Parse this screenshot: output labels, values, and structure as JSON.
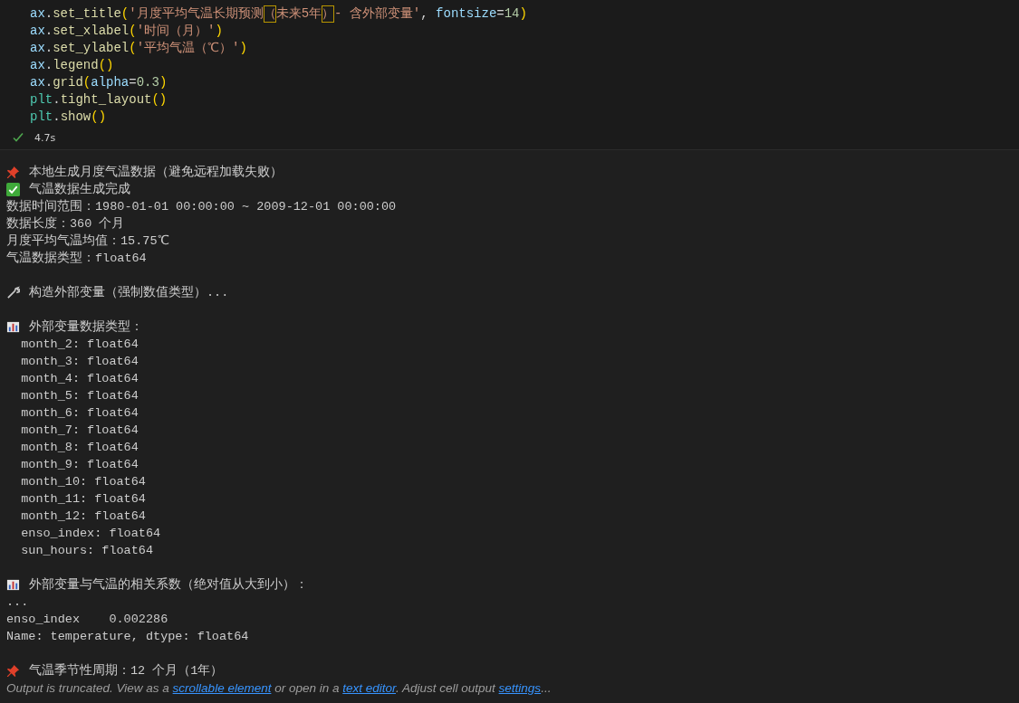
{
  "code_lines": [
    [
      {
        "kind": "var",
        "text": "ax"
      },
      {
        "kind": "op",
        "text": "."
      },
      {
        "kind": "fn",
        "text": "set_title"
      },
      {
        "kind": "paren",
        "text": "("
      },
      {
        "kind": "str",
        "text": "'月度平均气温长期预测"
      },
      {
        "kind": "str-match",
        "text": "（"
      },
      {
        "kind": "str",
        "text": "未来5年"
      },
      {
        "kind": "str-match",
        "text": "）"
      },
      {
        "kind": "str",
        "text": "- 含外部变量'"
      },
      {
        "kind": "op",
        "text": ", "
      },
      {
        "kind": "var",
        "text": "fontsize"
      },
      {
        "kind": "op",
        "text": "="
      },
      {
        "kind": "num",
        "text": "14"
      },
      {
        "kind": "paren",
        "text": ")"
      }
    ],
    [
      {
        "kind": "var",
        "text": "ax"
      },
      {
        "kind": "op",
        "text": "."
      },
      {
        "kind": "fn",
        "text": "set_xlabel"
      },
      {
        "kind": "paren",
        "text": "("
      },
      {
        "kind": "str",
        "text": "'时间（月）'"
      },
      {
        "kind": "paren",
        "text": ")"
      }
    ],
    [
      {
        "kind": "var",
        "text": "ax"
      },
      {
        "kind": "op",
        "text": "."
      },
      {
        "kind": "fn",
        "text": "set_ylabel"
      },
      {
        "kind": "paren",
        "text": "("
      },
      {
        "kind": "str",
        "text": "'平均气温（℃）'"
      },
      {
        "kind": "paren",
        "text": ")"
      }
    ],
    [
      {
        "kind": "var",
        "text": "ax"
      },
      {
        "kind": "op",
        "text": "."
      },
      {
        "kind": "fn",
        "text": "legend"
      },
      {
        "kind": "paren",
        "text": "()"
      }
    ],
    [
      {
        "kind": "var",
        "text": "ax"
      },
      {
        "kind": "op",
        "text": "."
      },
      {
        "kind": "fn",
        "text": "grid"
      },
      {
        "kind": "paren",
        "text": "("
      },
      {
        "kind": "var",
        "text": "alpha"
      },
      {
        "kind": "op",
        "text": "="
      },
      {
        "kind": "num",
        "text": "0.3"
      },
      {
        "kind": "paren",
        "text": ")"
      }
    ],
    [
      {
        "kind": "mod",
        "text": "plt"
      },
      {
        "kind": "op",
        "text": "."
      },
      {
        "kind": "fn",
        "text": "tight_layout"
      },
      {
        "kind": "paren",
        "text": "()"
      }
    ],
    [
      {
        "kind": "mod",
        "text": "plt"
      },
      {
        "kind": "op",
        "text": "."
      },
      {
        "kind": "fn",
        "text": "show"
      },
      {
        "kind": "paren",
        "text": "()"
      }
    ]
  ],
  "run_status": {
    "succeeded": true,
    "duration": "4.7s"
  },
  "output_blocks": [
    [
      {
        "kind": "pin",
        "text": "本地生成月度气温数据（避免远程加载失败）"
      },
      {
        "kind": "check",
        "text": "气温数据生成完成"
      },
      {
        "text": "数据时间范围：1980-01-01 00:00:00 ~ 2009-12-01 00:00:00"
      },
      {
        "text": "数据长度：360 个月"
      },
      {
        "text": "月度平均气温均值：15.75℃"
      },
      {
        "text": "气温数据类型：float64"
      }
    ],
    [
      {
        "kind": "wrench",
        "text": "构造外部变量（强制数值类型）..."
      }
    ],
    [
      {
        "kind": "chart",
        "text": "外部变量数据类型："
      },
      {
        "text": "  month_2: float64"
      },
      {
        "text": "  month_3: float64"
      },
      {
        "text": "  month_4: float64"
      },
      {
        "text": "  month_5: float64"
      },
      {
        "text": "  month_6: float64"
      },
      {
        "text": "  month_7: float64"
      },
      {
        "text": "  month_8: float64"
      },
      {
        "text": "  month_9: float64"
      },
      {
        "text": "  month_10: float64"
      },
      {
        "text": "  month_11: float64"
      },
      {
        "text": "  month_12: float64"
      },
      {
        "text": "  enso_index: float64"
      },
      {
        "text": "  sun_hours: float64"
      }
    ],
    [
      {
        "kind": "chart",
        "text": "外部变量与气温的相关系数（绝对值从大到小）："
      },
      {
        "text": "..."
      },
      {
        "text": "enso_index    0.002286"
      },
      {
        "text": "Name: temperature, dtype: float64"
      }
    ],
    [
      {
        "kind": "pin",
        "text": "气温季节性周期：12 个月（1年）"
      }
    ]
  ],
  "truncation_notice": [
    {
      "kind": "text",
      "text": "Output is truncated. View as a "
    },
    {
      "kind": "link",
      "text": "scrollable element"
    },
    {
      "kind": "text",
      "text": " or open in a "
    },
    {
      "kind": "link",
      "text": "text editor"
    },
    {
      "kind": "text",
      "text": ". Adjust cell output "
    },
    {
      "kind": "link",
      "text": "settings"
    },
    {
      "kind": "text",
      "text": "..."
    }
  ]
}
